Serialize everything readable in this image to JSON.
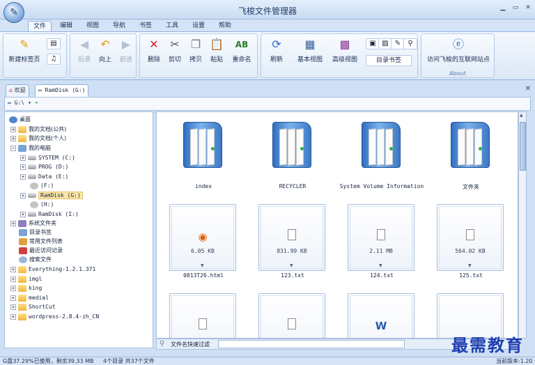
{
  "app": {
    "title": "飞梭文件管理器",
    "min": "▁",
    "max": "▭",
    "close": "✕"
  },
  "menu": [
    "文件",
    "编辑",
    "视图",
    "导航",
    "书签",
    "工具",
    "设置",
    "帮助"
  ],
  "ribbon": {
    "new_tab": "新建标签页",
    "back": "后退",
    "up": "向上",
    "forward": "前进",
    "delete": "删除",
    "cut": "剪切",
    "copy": "拷贝",
    "paste": "粘贴",
    "rename": "重命名",
    "refresh": "刷新",
    "basic_view": "基本视图",
    "advanced_view": "高级视图",
    "bookmark_dir": "目录书签",
    "visit_site": "访问飞梭的互联网站点",
    "about_group": "About"
  },
  "tabs": [
    {
      "label": "欢迎"
    },
    {
      "label": "RamDisk  (G:)"
    }
  ],
  "address": {
    "path": "G:\\"
  },
  "tree": [
    {
      "label": "桌面"
    },
    {
      "label": "我的文档(公共)"
    },
    {
      "label": "我的文档(个人)"
    },
    {
      "label": "我的电脑"
    },
    {
      "label": "SYSTEM   (C:)"
    },
    {
      "label": "PROG   (D:)"
    },
    {
      "label": "Data   (E:)"
    },
    {
      "label": "(F:)"
    },
    {
      "label": "RamDisk  (G:)"
    },
    {
      "label": "(H:)"
    },
    {
      "label": "RamDisk   (I:)"
    },
    {
      "label": "系统文件夹"
    },
    {
      "label": "目录书签"
    },
    {
      "label": "常用文件列表"
    },
    {
      "label": "最近访问记录"
    },
    {
      "label": "搜索文件"
    },
    {
      "label": "Everything-1.2.1.371"
    },
    {
      "label": "imgl"
    },
    {
      "label": "king"
    },
    {
      "label": "medial"
    },
    {
      "label": "ShortCut"
    },
    {
      "label": "wordpress-2.8.4-zh_CN"
    }
  ],
  "folders": [
    {
      "name": "index"
    },
    {
      "name": "RECYCLER"
    },
    {
      "name": "System Volume Information"
    },
    {
      "name": "文件夹"
    }
  ],
  "files": [
    {
      "name": "0813T26.html",
      "size": "6.05 KB"
    },
    {
      "name": "123.txt",
      "size": "831.99 KB"
    },
    {
      "name": "124.txt",
      "size": "2.11 MB"
    },
    {
      "name": "125.txt",
      "size": "564.02 KB"
    }
  ],
  "filter": {
    "label": "文件名快速过滤",
    "value": ""
  },
  "status": {
    "disk": "G盘37.29%已使用，剩余39.33 MB",
    "counts": "4个目录 共37个文件",
    "version": "当前版本:1.20"
  },
  "watermark": "最需教育",
  "colors": {
    "accent": "#2f6fc2",
    "selection": "#fbe6a8",
    "watermark": "#1f3fb0"
  }
}
